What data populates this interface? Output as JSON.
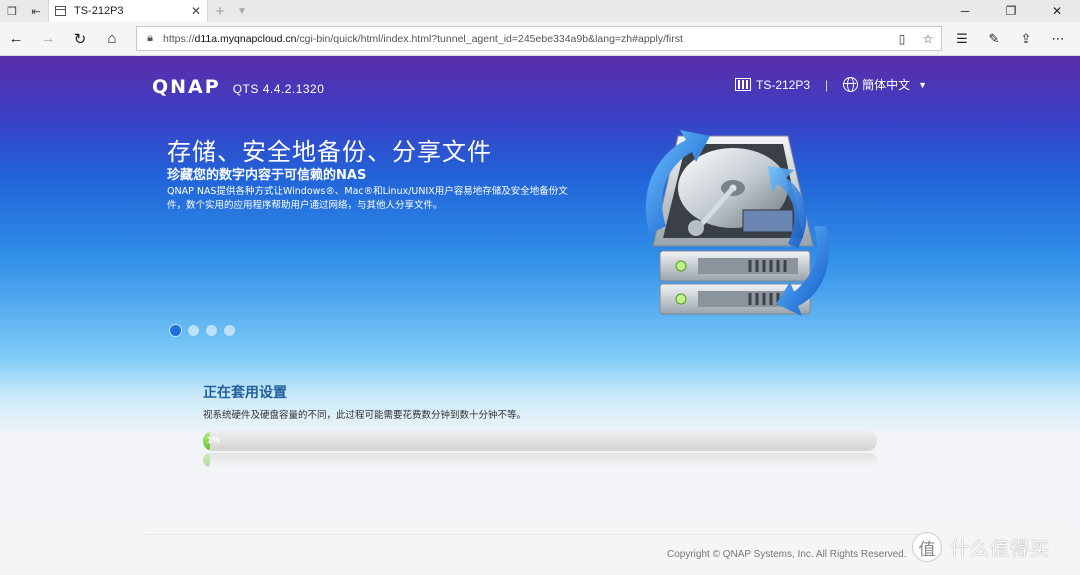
{
  "browser": {
    "tab_title": "TS-212P3",
    "tab_close": "✕",
    "tab_add": "+",
    "url_prefix": "https://",
    "url_host": "d11a.myqnapcloud.cn",
    "url_path": "/cgi-bin/quick/html/index.html?tunnel_agent_id=245ebe334a9b&lang=zh#apply/first",
    "icons": {
      "back": "arrow-left-icon",
      "forward": "arrow-right-icon",
      "refresh": "refresh-icon",
      "home": "home-icon",
      "lock": "lock-icon",
      "reading_view": "reading-view-icon",
      "favorite": "star-icon",
      "favorites_hub": "favorites-hub-icon",
      "notes": "pen-icon",
      "share": "share-icon",
      "more": "more-icon"
    }
  },
  "header": {
    "logo": "QNAP",
    "version": "QTS 4.4.2.1320",
    "device_name": "TS-212P3",
    "separator": "|",
    "language": "簡体中文"
  },
  "hero": {
    "headline": "存储、安全地备份、分享文件",
    "subheadline": "珍藏您的数字内容于可信赖的NAS",
    "description": "QNAP NAS提供各种方式让Windows®、Mac®和Linux/UNIX用户容易地存储及安全地备份文件，数个实用的应用程序帮助用户通过网络，与其他人分享文件。",
    "slides": 4,
    "active_slide": 0
  },
  "apply": {
    "title": "正在套用设置",
    "description": "视系统硬件及硬盘容量的不同，此过程可能需要花费数分钟到数十分钟不等。",
    "progress_percent": 1,
    "progress_label": "1%"
  },
  "footer": {
    "copyright": "Copyright © QNAP Systems, Inc. All Rights Reserved."
  },
  "watermark": {
    "badge": "值",
    "text": "什么值得买"
  },
  "colors": {
    "title_blue": "#23609c",
    "progress_green": "#65bf2d",
    "active_dot": "#1f6fd8"
  }
}
